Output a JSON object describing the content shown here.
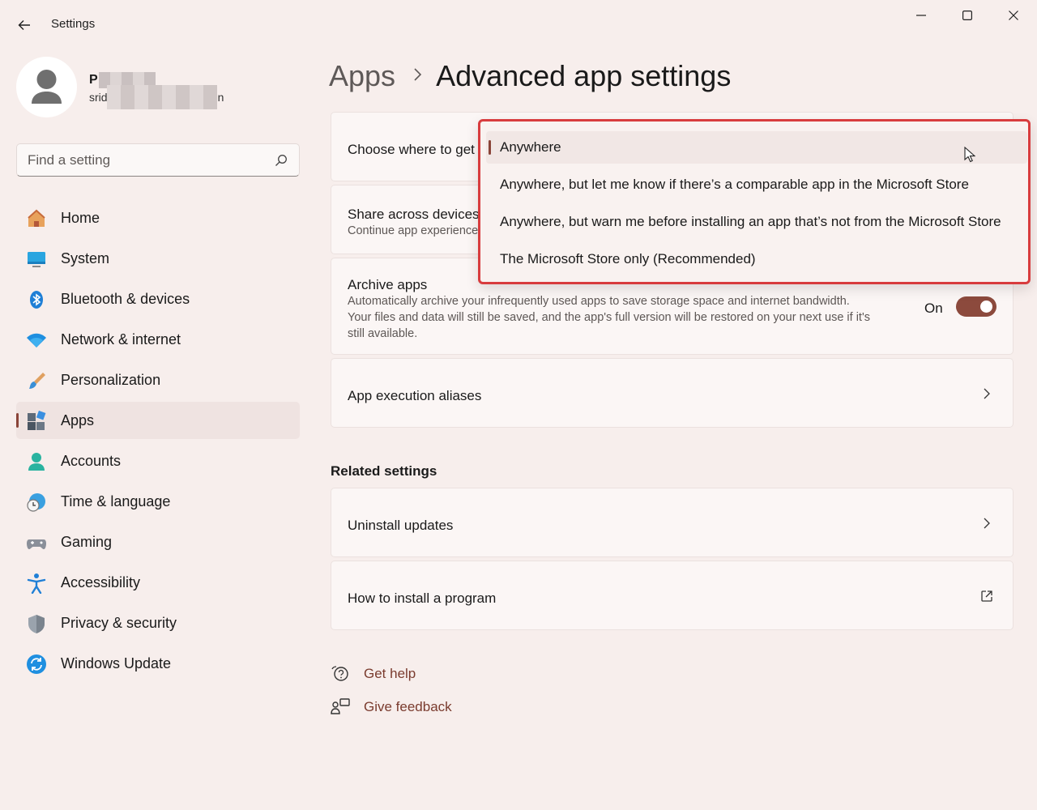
{
  "window": {
    "title": "Settings",
    "icons": {
      "back": "back-arrow-icon",
      "minimize": "minimize-icon",
      "maximize": "maximize-icon",
      "close": "close-icon"
    }
  },
  "profile": {
    "name": "P S",
    "email_prefix": "srid",
    "email_suffix": "n"
  },
  "search": {
    "placeholder": "Find a setting"
  },
  "nav": {
    "items": [
      {
        "label": "Home",
        "icon": "home-icon"
      },
      {
        "label": "System",
        "icon": "system-icon"
      },
      {
        "label": "Bluetooth & devices",
        "icon": "bluetooth-icon"
      },
      {
        "label": "Network & internet",
        "icon": "wifi-icon"
      },
      {
        "label": "Personalization",
        "icon": "brush-icon"
      },
      {
        "label": "Apps",
        "icon": "apps-icon",
        "active": true
      },
      {
        "label": "Accounts",
        "icon": "accounts-icon"
      },
      {
        "label": "Time & language",
        "icon": "time-language-icon"
      },
      {
        "label": "Gaming",
        "icon": "gaming-icon"
      },
      {
        "label": "Accessibility",
        "icon": "accessibility-icon"
      },
      {
        "label": "Privacy & security",
        "icon": "shield-icon"
      },
      {
        "label": "Windows Update",
        "icon": "windows-update-icon"
      }
    ]
  },
  "breadcrumb": {
    "parent": "Apps",
    "current": "Advanced app settings"
  },
  "cards": {
    "choose_where": {
      "title": "Choose where to get"
    },
    "share_across": {
      "title": "Share across devices",
      "desc": "Continue app experience"
    },
    "archive": {
      "title": "Archive apps",
      "desc1": "Automatically archive your infrequently used apps to save storage space and internet bandwidth.",
      "desc2": "Your files and data will still be saved, and the app's full version will be restored on your next use if it's",
      "desc3": "still available.",
      "toggle_label": "On",
      "toggle_on": true
    },
    "aliases": {
      "title": "App execution aliases"
    }
  },
  "related": {
    "title": "Related settings",
    "items": [
      {
        "title": "Uninstall updates",
        "icon": "chevron-right-icon"
      },
      {
        "title": "How to install a program",
        "icon": "external-link-icon"
      }
    ]
  },
  "help": {
    "get_help": "Get help",
    "give_feedback": "Give feedback"
  },
  "dropdown": {
    "options": [
      {
        "label": "Anywhere",
        "selected": true
      },
      {
        "label": "Anywhere, but let me know if there’s a comparable app in the Microsoft Store"
      },
      {
        "label": "Anywhere, but warn me before installing an app that’s not from the Microsoft Store"
      },
      {
        "label": "The Microsoft Store only (Recommended)"
      }
    ],
    "highlight_color": "#d83c3e"
  },
  "colors": {
    "accent": "#8a4438",
    "link": "#7a3b2e",
    "background": "#f7eeec"
  }
}
